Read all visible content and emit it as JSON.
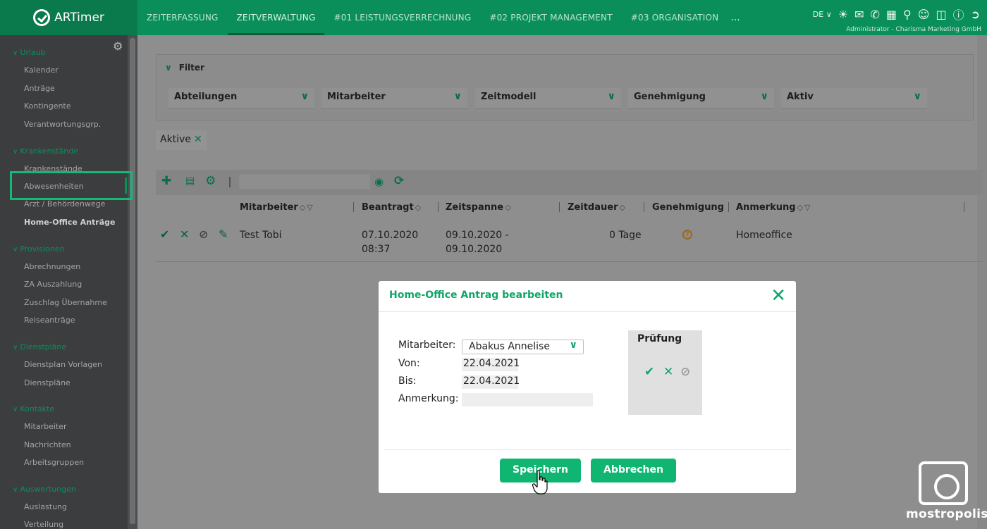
{
  "app": {
    "name": "ARTimer"
  },
  "nav": [
    "ZEITERFASSUNG",
    "ZEITVERWALTUNG",
    "#01 LEISTUNGSVERRECHNUNG",
    "#02 PROJEKT MANAGEMENT",
    "#03 ORGANISATION"
  ],
  "nav_more": "...",
  "header": {
    "lang": "DE",
    "user": "Administrator - Charisma Marketing GmbH"
  },
  "sidebar": {
    "groups": [
      {
        "label": "Urlaub",
        "items": [
          "Kalender",
          "Anträge",
          "Kontingente",
          "Verantwortungsgrp."
        ]
      },
      {
        "label": "Krankenstände",
        "items": [
          "Krankenstände",
          "Abwesenheiten",
          "Arzt / Behördenwege",
          "Home-Office Anträge"
        ]
      },
      {
        "label": "Provisionen",
        "items": [
          "Abrechnungen",
          "ZA Auszahlung",
          "Zuschlag Übernahme",
          "Reiseanträge"
        ]
      },
      {
        "label": "Dienstpläne",
        "items": [
          "Dienstplan Vorlagen",
          "Dienstpläne"
        ]
      },
      {
        "label": "Kontakte",
        "items": [
          "Mitarbeiter",
          "Nachrichten",
          "Arbeitsgruppen"
        ]
      },
      {
        "label": "Auswertungen",
        "items": [
          "Auslastung",
          "Verteilung"
        ]
      }
    ]
  },
  "filter": {
    "title": "Filter",
    "selects": [
      "Abteilungen",
      "Mitarbeiter",
      "Zeitmodell",
      "Genehmigung",
      "Aktiv"
    ],
    "chip": "Aktive"
  },
  "table": {
    "columns": [
      "Mitarbeiter",
      "Beantragt",
      "Zeitspanne",
      "Zeitdauer",
      "Genehmigung",
      "Anmerkung"
    ],
    "rows": [
      {
        "mitarbeiter": "Test Tobi",
        "beantragt_date": "07.10.2020",
        "beantragt_time": "08:37",
        "zeitspanne_from": "09.10.2020 -",
        "zeitspanne_to": "09.10.2020",
        "zeitdauer": "0 Tage",
        "anmerkung": "Homeoffice"
      }
    ]
  },
  "modal": {
    "title": "Home-Office Antrag bearbeiten",
    "labels": {
      "mitarbeiter": "Mitarbeiter:",
      "von": "Von:",
      "bis": "Bis:",
      "anmerkung": "Anmerkung:"
    },
    "mitarbeiter_value": "Abakus Annelise",
    "von_value": "22.04.2021",
    "bis_value": "22.04.2021",
    "anmerkung_value": "",
    "pruefung_title": "Prüfung",
    "save_label": "Speichern",
    "cancel_label": "Abbrechen"
  },
  "watermark": {
    "text": "mostropolis"
  },
  "colors": {
    "brand": "#0b8f5a",
    "accent": "#10b572",
    "sidebar": "#3c3d3f"
  }
}
